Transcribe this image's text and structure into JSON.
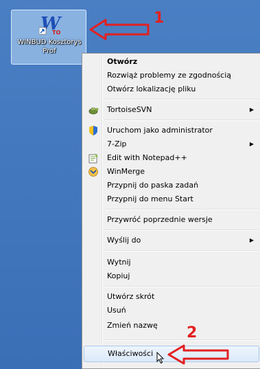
{
  "desktop_icon": {
    "caption": "WINBUD Kosztorys\nProf",
    "logo_letter": "W",
    "logo_sub": "TO"
  },
  "annotations": {
    "num1": "1",
    "num2": "2",
    "color": "#e32020"
  },
  "context_menu": {
    "items": [
      {
        "label": "Otwórz",
        "bold": true
      },
      {
        "label": "Rozwiąż problemy ze zgodnością"
      },
      {
        "label": "Otwórz lokalizację pliku"
      },
      {
        "label": "TortoiseSVN",
        "icon": "tortoise-svn-icon",
        "submenu": true
      },
      {
        "label": "Uruchom jako administrator",
        "icon": "shield-icon"
      },
      {
        "label": "7-Zip",
        "submenu": true
      },
      {
        "label": "Edit with Notepad++",
        "icon": "notepad-plus-plus-icon"
      },
      {
        "label": "WinMerge",
        "icon": "winmerge-icon"
      },
      {
        "label": "Przypnij do paska zadań"
      },
      {
        "label": "Przypnij do menu Start"
      },
      {
        "label": "Przywróć poprzednie wersje"
      },
      {
        "label": "Wyślij do",
        "submenu": true
      },
      {
        "label": "Wytnij"
      },
      {
        "label": "Kopiuj"
      },
      {
        "label": "Utwórz skrót"
      },
      {
        "label": "Usuń"
      },
      {
        "label": "Zmień nazwę"
      },
      {
        "label": "Właściwości",
        "hovered": true
      }
    ],
    "submenu_glyph": "▶"
  }
}
